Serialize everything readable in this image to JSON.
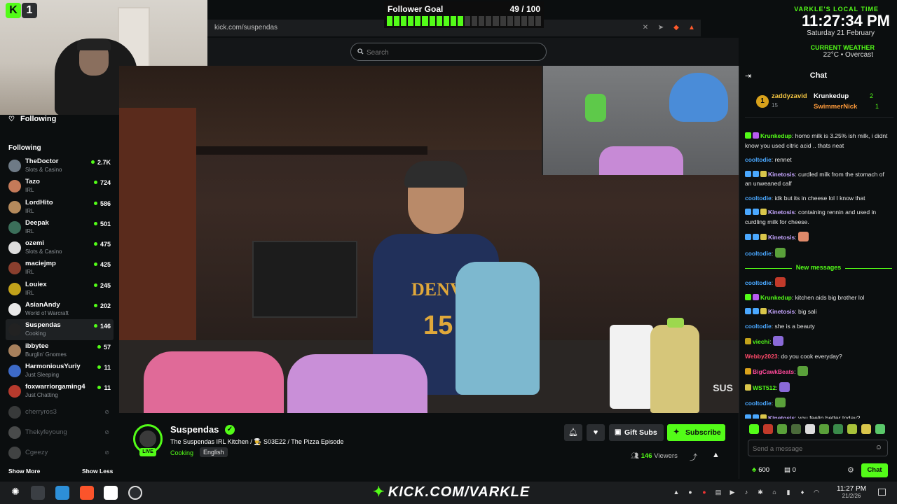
{
  "overlay": {
    "k_label": "K",
    "k_number": "1",
    "goal": {
      "title": "Follower Goal",
      "count": "49 / 100",
      "current": 49,
      "target": 100,
      "segments": 22,
      "segments_on": 11
    },
    "clock": {
      "label": "VARKLE'S LOCAL TIME",
      "time": "11:27:34 PM",
      "date": "Saturday 21 February",
      "weather_label": "CURRENT WEATHER",
      "weather_value": "22°C • Overcast"
    }
  },
  "browser": {
    "url": "kick.com/suspendas"
  },
  "search": {
    "placeholder": "Search"
  },
  "sidebar": {
    "header": "Following",
    "subheader": "Following",
    "show_more": "Show More",
    "show_less": "Show Less",
    "items": [
      {
        "name": "TheDoctor",
        "category": "Slots & Casino",
        "viewers": "2.7K",
        "color": "#6e7a86"
      },
      {
        "name": "Tazo",
        "category": "IRL",
        "viewers": "724",
        "color": "#c47a59"
      },
      {
        "name": "LordHito",
        "category": "IRL",
        "viewers": "586",
        "color": "#b48a5c"
      },
      {
        "name": "Deepak",
        "category": "IRL",
        "viewers": "501",
        "color": "#3b6f5a"
      },
      {
        "name": "ozemi",
        "category": "Slots & Casino",
        "viewers": "475",
        "color": "#dddddd"
      },
      {
        "name": "maciejmp",
        "category": "IRL",
        "viewers": "425",
        "color": "#8a3f2e"
      },
      {
        "name": "Louiex",
        "category": "IRL",
        "viewers": "245",
        "color": "#c2a21a"
      },
      {
        "name": "AsianAndy",
        "category": "World of Warcraft",
        "viewers": "202",
        "color": "#e9e9e9"
      },
      {
        "name": "Suspendas",
        "category": "Cooking",
        "viewers": "146",
        "color": "#222222"
      },
      {
        "name": "ibbytee",
        "category": "Burglin' Gnomes",
        "viewers": "57",
        "color": "#a7805c"
      },
      {
        "name": "HarmoniousYuriy",
        "category": "Just Sleeping",
        "viewers": "11",
        "color": "#3d6ac7"
      },
      {
        "name": "foxwarriorgaming4",
        "category": "Just Chatting",
        "viewers": "11",
        "color": "#b63a2d"
      }
    ],
    "offline": [
      {
        "name": "cherryros3",
        "color": "#666666"
      },
      {
        "name": "Thekyfeyoung",
        "color": "#888888"
      },
      {
        "name": "Cgeezy",
        "color": "#777777"
      }
    ]
  },
  "video": {
    "jersey_text": "DENVER",
    "jersey_number": "15",
    "watermark": "SUS"
  },
  "stream": {
    "channel": "Suspendas",
    "live": "LIVE",
    "title": "The Suspendas IRL Kitchen / 👨‍🍳 S03E22 / The Pizza Episode",
    "category": "Cooking",
    "language": "English",
    "gift_subs": "Gift Subs",
    "subscribe": "Subscribe",
    "viewers_count": "146",
    "viewers_label": "Viewers"
  },
  "chat": {
    "title": "Chat",
    "leaderboard": [
      {
        "rank": "1",
        "user": "zaddyzavid",
        "count": "15"
      },
      {
        "user": "Krunkedup",
        "count": "2"
      },
      {
        "user": "SwimmerNick",
        "count": "1"
      }
    ],
    "new_messages": "New messages",
    "messages_before": [
      {
        "user": "Krunkedup",
        "color": "#53fc18",
        "badges": [
          "#53fc18",
          "#b85cf0"
        ],
        "text": "homo milk is 3.25% ish milk, i didnt know you used citric acid .. thats neat"
      },
      {
        "user": "cooltodie",
        "color": "#4aa8ff",
        "badges": [],
        "text": "rennet"
      },
      {
        "user": "Kinetosis",
        "color": "#c6a6ff",
        "badges": [
          "#4aa8ff",
          "#4aa8ff",
          "#d9c64b"
        ],
        "text": "curdled milk from the stomach of an unweaned calf"
      },
      {
        "user": "cooltodie",
        "color": "#4aa8ff",
        "badges": [],
        "text": "idk but its in cheese lol I know that"
      },
      {
        "user": "Kinetosis",
        "color": "#c6a6ff",
        "badges": [
          "#4aa8ff",
          "#4aa8ff",
          "#d9c64b"
        ],
        "text": "containing rennin and used in curdling milk for cheese."
      },
      {
        "user": "Kinetosis",
        "color": "#c6a6ff",
        "badges": [
          "#4aa8ff",
          "#4aa8ff",
          "#d9c64b"
        ],
        "text": "",
        "emote": "#e08a6a"
      },
      {
        "user": "cooltodie",
        "color": "#4aa8ff",
        "badges": [],
        "text": "",
        "emote": "#5aa03a"
      }
    ],
    "messages_after": [
      {
        "user": "cooltodie",
        "color": "#4aa8ff",
        "badges": [],
        "text": "",
        "emote": "#c23a2a"
      },
      {
        "user": "Krunkedup",
        "color": "#53fc18",
        "badges": [
          "#53fc18",
          "#b85cf0"
        ],
        "text": "kitchen aids big brother lol"
      },
      {
        "user": "Kinetosis",
        "color": "#c6a6ff",
        "badges": [
          "#4aa8ff",
          "#4aa8ff",
          "#d9c64b"
        ],
        "text": "big sali"
      },
      {
        "user": "cooltodie",
        "color": "#4aa8ff",
        "badges": [],
        "text": "she is a beauty"
      },
      {
        "user": "viechi",
        "color": "#53fc18",
        "badges": [
          "#c2a21a"
        ],
        "text": "",
        "emote": "#8a6ad8"
      },
      {
        "user": "Webby2023",
        "color": "#ff4a6a",
        "badges": [],
        "text": "do you cook everyday?"
      },
      {
        "user": "BigCawkBeats",
        "color": "#ff4a9a",
        "badges": [
          "#d9a21b"
        ],
        "text": "",
        "emote": "#5aa03a"
      },
      {
        "user": "WST512",
        "color": "#53fc18",
        "badges": [
          "#d9c64b"
        ],
        "text": "",
        "emote": "#8a6ad8"
      },
      {
        "user": "cooltodie",
        "color": "#4aa8ff",
        "badges": [],
        "text": "",
        "emote": "#5aa03a"
      },
      {
        "user": "Kinetosis",
        "color": "#c6a6ff",
        "badges": [
          "#4aa8ff",
          "#4aa8ff",
          "#d9c64b"
        ],
        "text": "you feelin better today?"
      }
    ],
    "emote_picker": [
      "#53fc18",
      "#c23a2a",
      "#5aa03a",
      "#4a6a3a",
      "#dddddd",
      "#5aa03a",
      "#3a8a4a",
      "#a8c23a",
      "#d9c64b",
      "#5ac86a"
    ],
    "input_placeholder": "Send a message",
    "points": "600",
    "inventory": "0",
    "chat_button": "Chat"
  },
  "taskbar": {
    "banner": "KICK.COM/VARKLE",
    "time": "11:27 PM",
    "date": "21/2/26"
  }
}
